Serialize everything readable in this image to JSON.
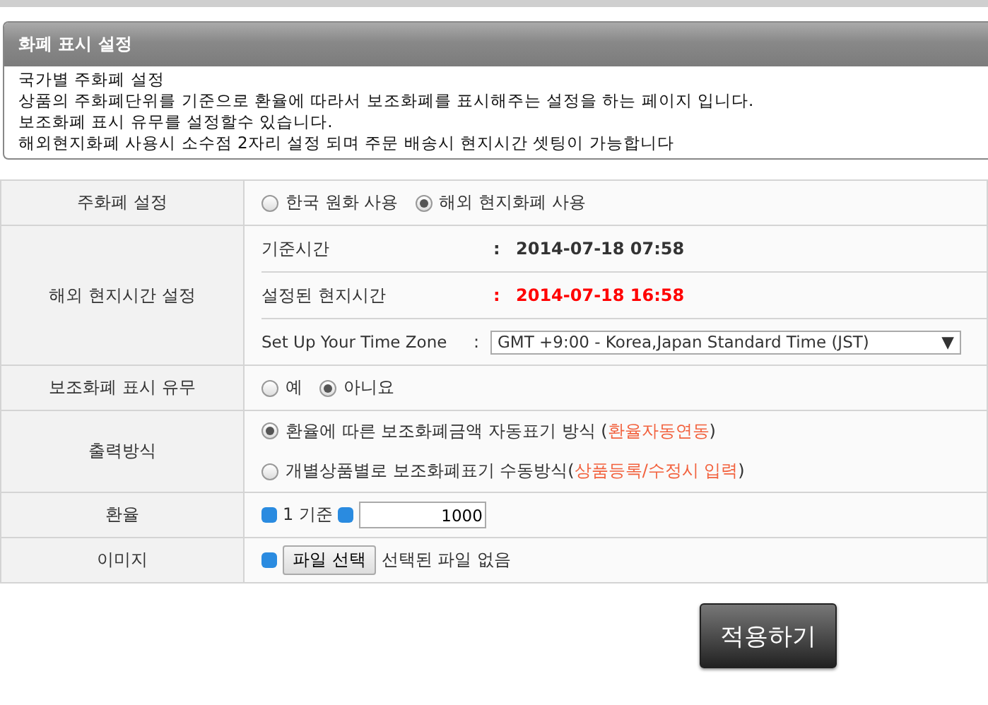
{
  "panel": {
    "title": "화폐 표시 설정",
    "lines": [
      "국가별 주화폐 설정",
      "상품의 주화폐단위를 기준으로 환율에 따라서 보조화폐를 표시해주는 설정을 하는 페이지 입니다.",
      "보조화폐 표시 유무를 설정할수 있습니다.",
      "해외현지화폐 사용시 소수점 2자리 설정 되며 주문 배송시 현지시간 셋팅이 가능합니다"
    ]
  },
  "rows": [
    {
      "kind": "radios",
      "label": "주화폐 설정",
      "options": [
        {
          "text": "한국 원화 사용",
          "selected": false
        },
        {
          "text": "해외 현지화폐 사용",
          "selected": true
        }
      ]
    },
    {
      "kind": "time",
      "label": "해외 현지시간 설정",
      "base": {
        "label": "기준시간",
        "colon": ":",
        "value": "2014-07-18 07:58"
      },
      "local": {
        "label": "설정된 현지시간",
        "colon": ":",
        "value": "2014-07-18 16:58"
      },
      "zone": {
        "label": "Set Up Your Time Zone",
        "colon": ":",
        "value": "GMT +9:00 - Korea,Japan Standard Time (JST)",
        "arrow": "▼"
      }
    },
    {
      "kind": "radios",
      "label": "보조화폐 표시 유무",
      "options": [
        {
          "text": "예",
          "selected": false
        },
        {
          "text": "아니요",
          "selected": true
        }
      ]
    },
    {
      "kind": "stacked",
      "label": "출력방식",
      "options": [
        {
          "text": "환율에 따른 보조화폐금액 자동표기 방식 (",
          "highlight": "환율자동연동",
          "suffix": ")",
          "selected": true
        },
        {
          "text": "개별상품별로 보조화폐표기 수동방식(",
          "highlight": "상품등록/수정시 입력",
          "suffix": ")",
          "selected": false
        }
      ]
    },
    {
      "kind": "rate",
      "label": "환율",
      "unit": "1 기준",
      "value": "1000"
    },
    {
      "kind": "file",
      "label": "이미지",
      "button": "파일 선택",
      "status": "선택된 파일 없음"
    }
  ],
  "apply_button": "적용하기"
}
